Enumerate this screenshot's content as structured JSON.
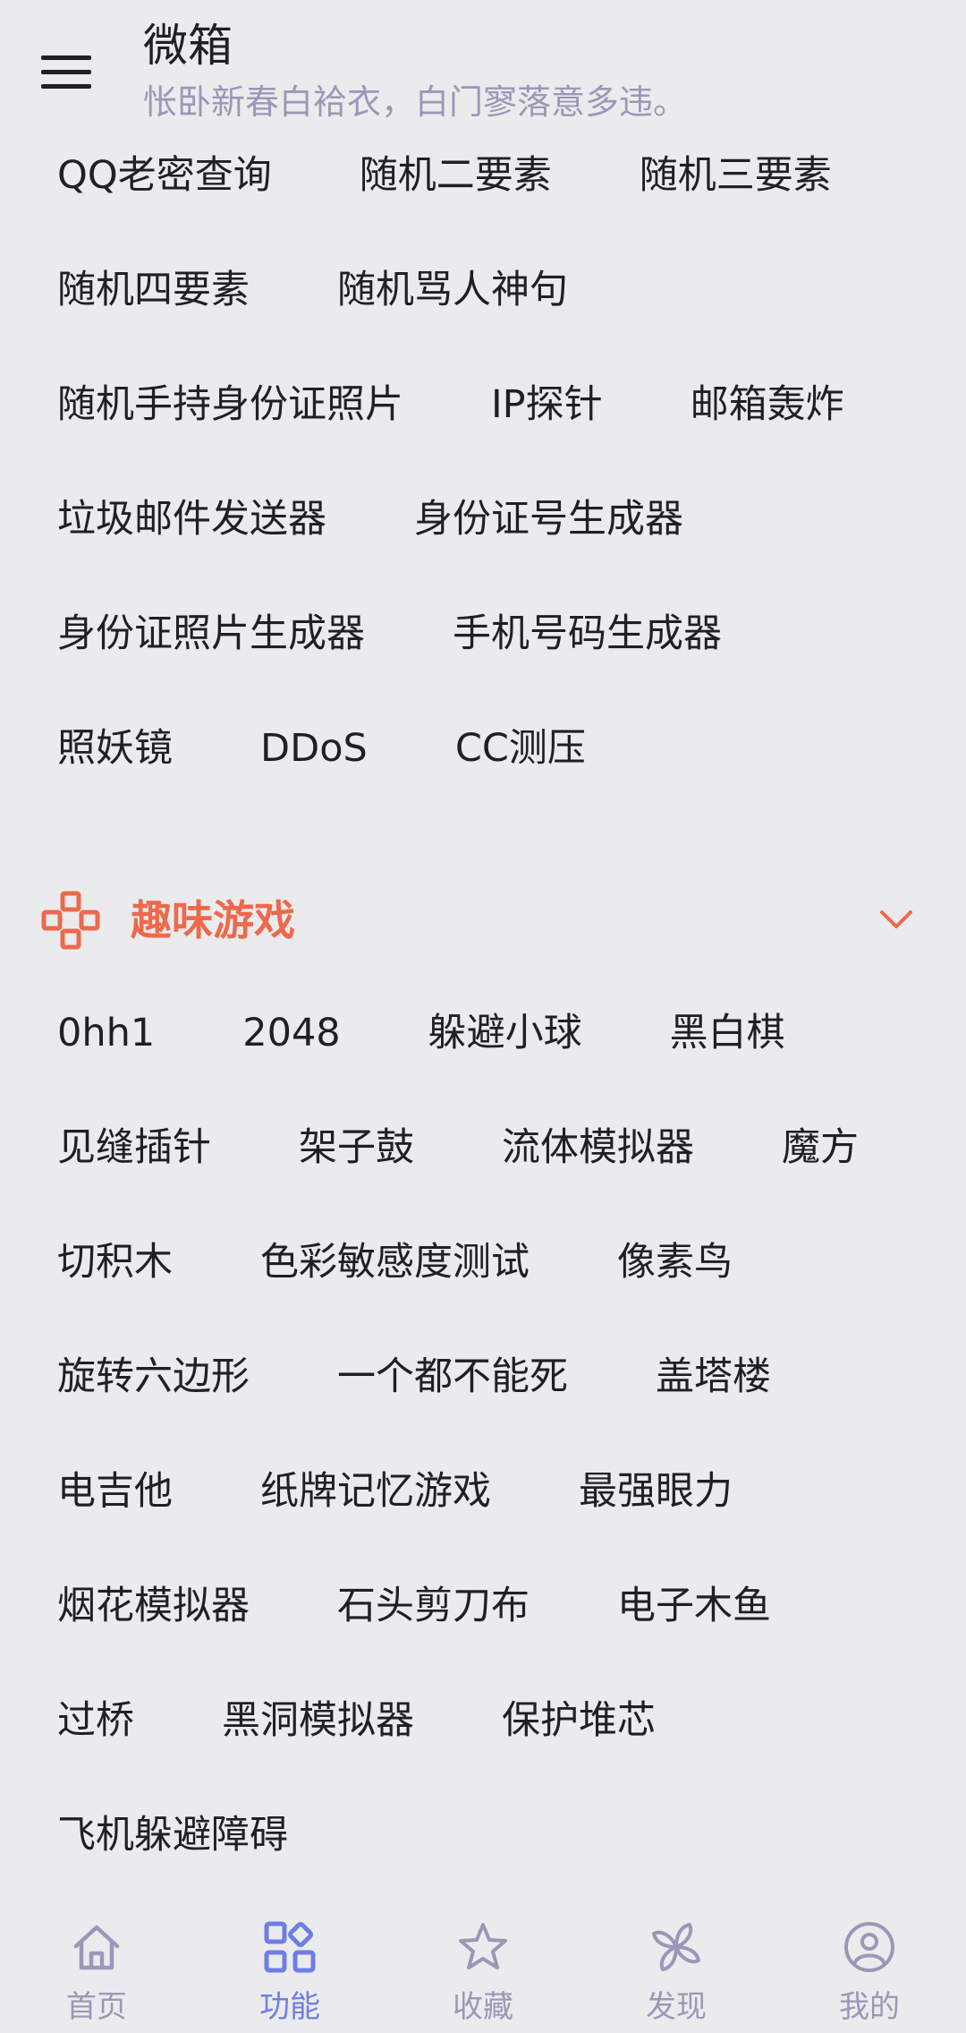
{
  "header": {
    "title": "微箱",
    "subtitle": "怅卧新春白袷衣，白门寥落意多违。"
  },
  "tools_rows": [
    [
      "QQ老密查询",
      "随机二要素",
      "随机三要素"
    ],
    [
      "随机四要素",
      "随机骂人神句"
    ],
    [
      "随机手持身份证照片",
      "IP探针",
      "邮箱轰炸"
    ],
    [
      "垃圾邮件发送器",
      "身份证号生成器"
    ],
    [
      "身份证照片生成器",
      "手机号码生成器"
    ],
    [
      "照妖镜",
      "DDoS",
      "CC测压"
    ]
  ],
  "games_section": {
    "title": "趣味游戏",
    "icon": "gamepad-icon",
    "expand_icon": "chevron-down-icon",
    "accent_color": "#ec6a4b"
  },
  "games_rows": [
    [
      "0hh1",
      "2048",
      "躲避小球",
      "黑白棋"
    ],
    [
      "见缝插针",
      "架子鼓",
      "流体模拟器",
      "魔方"
    ],
    [
      "切积木",
      "色彩敏感度测试",
      "像素鸟"
    ],
    [
      "旋转六边形",
      "一个都不能死",
      "盖塔楼"
    ],
    [
      "电吉他",
      "纸牌记忆游戏",
      "最强眼力"
    ],
    [
      "烟花模拟器",
      "石头剪刀布",
      "电子木鱼"
    ],
    [
      "过桥",
      "黑洞模拟器",
      "保护堆芯"
    ],
    [
      "飞机躲避障碍"
    ]
  ],
  "bottom_nav": [
    {
      "label": "首页",
      "icon": "home-icon",
      "active": false
    },
    {
      "label": "功能",
      "icon": "apps-icon",
      "active": true
    },
    {
      "label": "收藏",
      "icon": "star-icon",
      "active": false
    },
    {
      "label": "发现",
      "icon": "pinwheel-icon",
      "active": false
    },
    {
      "label": "我的",
      "icon": "profile-icon",
      "active": false
    }
  ],
  "colors": {
    "background": "#ebebed",
    "text": "#1f1f24",
    "muted": "#9a98b8",
    "nav_active": "#6f7de6"
  }
}
